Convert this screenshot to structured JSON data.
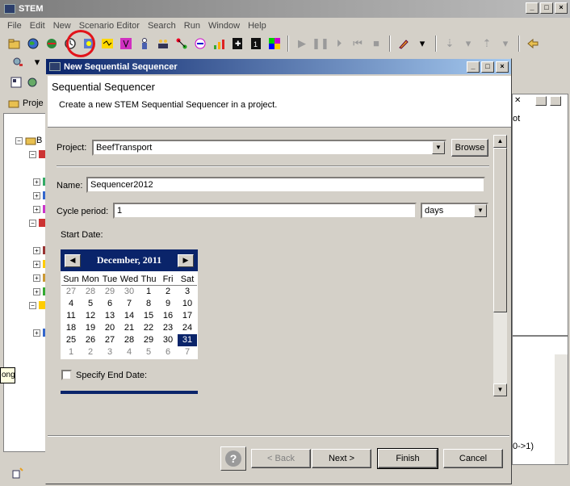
{
  "window": {
    "title": "STEM",
    "minimize": "_",
    "maximize": "□",
    "close": "×"
  },
  "menu": [
    "File",
    "Edit",
    "New",
    "Scenario Editor",
    "Search",
    "Run",
    "Window",
    "Help"
  ],
  "background": {
    "project_tab": "Proje",
    "tree_root_label": "B",
    "right_panel_text": "ot",
    "bottom_right_text": "0->1)",
    "tooltip": "ong"
  },
  "dialog": {
    "title": "New Sequential Sequencer",
    "header_title": "Sequential Sequencer",
    "header_desc": "Create a new STEM Sequential Sequencer in a project.",
    "project_label": "Project:",
    "project_value": "BeefTransport",
    "browse_label": "Browse",
    "name_label": "Name:",
    "name_value": "Sequencer2012",
    "cycle_label": "Cycle period:",
    "cycle_value": "1",
    "cycle_unit": "days",
    "start_date_label": "Start Date:",
    "specify_end_label": "Specify End Date:",
    "back_label": "< Back",
    "next_label": "Next >",
    "finish_label": "Finish",
    "cancel_label": "Cancel",
    "help_symbol": "?"
  },
  "calendar": {
    "month_title": "December, 2011",
    "prev": "◀",
    "next": "▶",
    "days_of_week": [
      "Sun",
      "Mon",
      "Tue",
      "Wed",
      "Thu",
      "Fri",
      "Sat"
    ],
    "weeks": [
      [
        "27",
        "28",
        "29",
        "30",
        "1",
        "2",
        "3"
      ],
      [
        "4",
        "5",
        "6",
        "7",
        "8",
        "9",
        "10"
      ],
      [
        "11",
        "12",
        "13",
        "14",
        "15",
        "16",
        "17"
      ],
      [
        "18",
        "19",
        "20",
        "21",
        "22",
        "23",
        "24"
      ],
      [
        "25",
        "26",
        "27",
        "28",
        "29",
        "30",
        "31"
      ],
      [
        "1",
        "2",
        "3",
        "4",
        "5",
        "6",
        "7"
      ]
    ],
    "selected_day": "31"
  }
}
